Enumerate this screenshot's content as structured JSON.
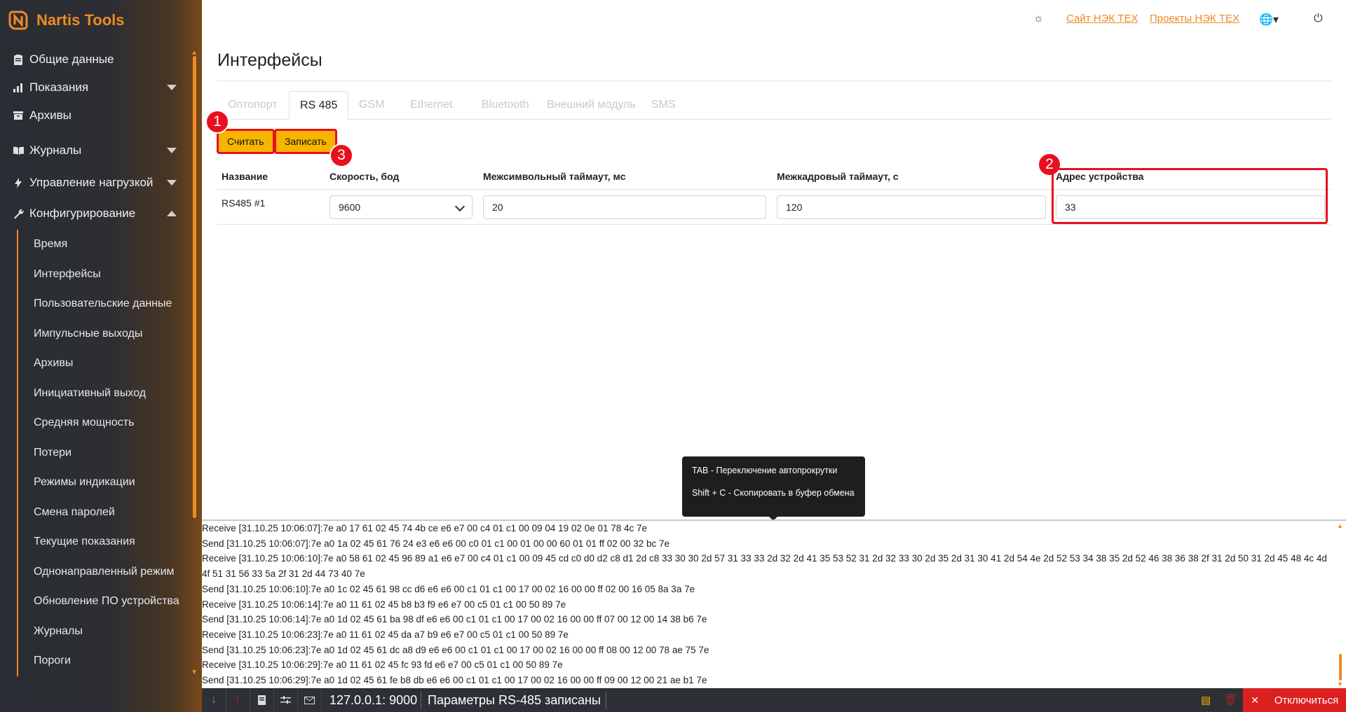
{
  "app": {
    "name": "Nartis Tools"
  },
  "header": {
    "link1": "Сайт НЭК ТЕХ",
    "link2": "Проекты НЭК ТЕХ"
  },
  "sidebar": {
    "items": [
      {
        "label": "Общие данные",
        "icon": "clipboard-icon"
      },
      {
        "label": "Показания",
        "icon": "bar-chart-icon"
      },
      {
        "label": "Архивы",
        "icon": "archive-box-icon"
      },
      {
        "label": "Журналы",
        "icon": "book-icon"
      },
      {
        "label": "Управление нагрузкой",
        "icon": "lightning-icon"
      },
      {
        "label": "Конфигурирование",
        "icon": "wrench-icon"
      }
    ],
    "submenu": [
      "Время",
      "Интерфейсы",
      "Пользовательские данные",
      "Импульсные выходы",
      "Архивы",
      "Инициативный выход",
      "Средняя мощность",
      "Потери",
      "Режимы индикации",
      "Смена паролей",
      "Текущие показания",
      "Однонаправленный режим",
      "Обновление ПО устройства",
      "Журналы",
      "Пороги"
    ]
  },
  "page": {
    "title": "Интерфейсы"
  },
  "tabs": [
    "Оптопорт",
    "RS 485",
    "GSM",
    "Ethernet",
    "Bluetooth",
    "Внешний модуль",
    "SMS"
  ],
  "actions": {
    "read": "Считать",
    "write": "Записать"
  },
  "markers": [
    "1",
    "2",
    "3"
  ],
  "table": {
    "headers": [
      "Название",
      "Скорость, бод",
      "Межсимвольный таймаут, мс",
      "Межкадровый таймаут, с",
      "Адрес устройства"
    ],
    "row": {
      "name": "RS485 #1",
      "speed": "9600",
      "char_timeout": "20",
      "frame_timeout": "120",
      "address": "33"
    }
  },
  "tooltip": {
    "line1": "TAB - Переключение автопрокрутки",
    "line2": "Shift + C - Скопировать в буфер обмена"
  },
  "log": [
    "Receive [31.10.25 10:06:07]:7e a0 17 61 02 45 74 4b ce e6 e7 00 c4 01 c1 00 09 04 19 02 0e 01 78 4c 7e",
    "Send [31.10.25 10:06:07]:7e a0 1a 02 45 61 76 24 e3 e6 e6 00 c0 01 c1 00 01 00 00 60 01 01 ff 02 00 32 bc 7e",
    "Receive [31.10.25 10:06:10]:7e a0 58 61 02 45 96 89 a1 e6 e7 00 c4 01 c1 00 09 45 cd c0 d0 d2 c8 d1 2d c8 33 30 30 2d 57 31 33 33 2d 32 2d 41 35 53 52 31 2d 32 33 30 2d 35 2d 31 30 41 2d 54 4e 2d 52 53 34 38 35 2d 52 46 38 36 38 2f 31 2d 50 31 2d 45 48 4c 4d 4f 51 31 56 33 5a 2f 31 2d 44 73 40 7e",
    "Send [31.10.25 10:06:10]:7e a0 1c 02 45 61 98 cc d6 e6 e6 00 c1 01 c1 00 17 00 02 16 00 00 ff 02 00 16 05 8a 3a 7e",
    "Receive [31.10.25 10:06:14]:7e a0 11 61 02 45 b8 b3 f9 e6 e7 00 c5 01 c1 00 50 89 7e",
    "Send [31.10.25 10:06:14]:7e a0 1d 02 45 61 ba 98 df e6 e6 00 c1 01 c1 00 17 00 02 16 00 00 ff 07 00 12 00 14 38 b6 7e",
    "Receive [31.10.25 10:06:23]:7e a0 11 61 02 45 da a7 b9 e6 e7 00 c5 01 c1 00 50 89 7e",
    "Send [31.10.25 10:06:23]:7e a0 1d 02 45 61 dc a8 d9 e6 e6 00 c1 01 c1 00 17 00 02 16 00 00 ff 08 00 12 00 78 ae 75 7e",
    "Receive [31.10.25 10:06:29]:7e a0 11 61 02 45 fc 93 fd e6 e7 00 c5 01 c1 00 50 89 7e",
    "Send [31.10.25 10:06:29]:7e a0 1d 02 45 61 fe b8 db e6 e6 00 c1 01 c1 00 17 00 02 16 00 00 ff 09 00 12 00 21 ae b1 7e"
  ],
  "status": {
    "address": "127.0.0.1: 9000",
    "message": "Параметры RS-485 записаны",
    "disconnect": "Отключиться"
  },
  "colors": {
    "accent": "#f08a24",
    "button": "#f7b500",
    "highlight": "#e8101e",
    "sidebar": "#2c2e33",
    "danger": "#dc2020"
  }
}
